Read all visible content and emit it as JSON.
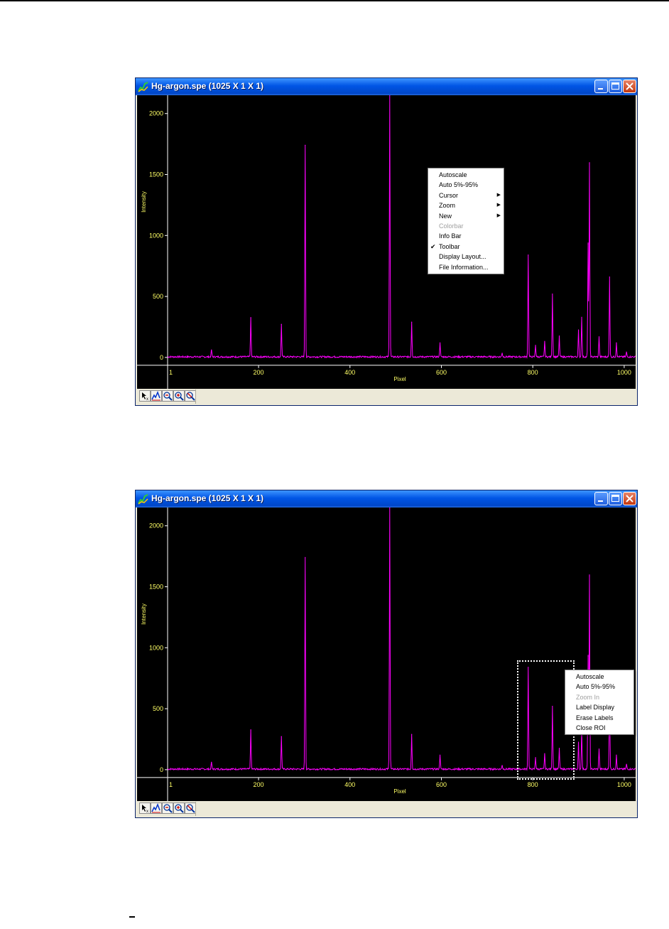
{
  "window_title": "Hg-argon.spe (1025 X 1 X 1)",
  "chart_data": {
    "type": "line",
    "xlabel": "Pixel",
    "ylabel": "Intensity",
    "xlim": [
      1,
      1025
    ],
    "ylim": [
      -30,
      2150
    ],
    "x_ticks": [
      1,
      200,
      400,
      600,
      800,
      1000
    ],
    "y_ticks": [
      0,
      500,
      1000,
      1500,
      2000
    ],
    "grid": false,
    "line_color": "#ff00ff",
    "axis_color": "#ffff66",
    "baseline": 5,
    "peaks": [
      {
        "x": 97,
        "y": 60
      },
      {
        "x": 183,
        "y": 320
      },
      {
        "x": 250,
        "y": 270
      },
      {
        "x": 302,
        "y": 1740
      },
      {
        "x": 487,
        "y": 2150
      },
      {
        "x": 535,
        "y": 290
      },
      {
        "x": 597,
        "y": 120
      },
      {
        "x": 733,
        "y": 35
      },
      {
        "x": 790,
        "y": 840
      },
      {
        "x": 806,
        "y": 100
      },
      {
        "x": 826,
        "y": 130
      },
      {
        "x": 843,
        "y": 520
      },
      {
        "x": 858,
        "y": 170
      },
      {
        "x": 900,
        "y": 220
      },
      {
        "x": 907,
        "y": 330
      },
      {
        "x": 921,
        "y": 930
      },
      {
        "x": 924,
        "y": 1590
      },
      {
        "x": 945,
        "y": 170
      },
      {
        "x": 968,
        "y": 660
      },
      {
        "x": 983,
        "y": 120
      },
      {
        "x": 1005,
        "y": 40
      }
    ]
  },
  "context_menu_1": {
    "items": [
      {
        "label": "Autoscale",
        "enabled": true,
        "submenu": false,
        "checked": false
      },
      {
        "label": "Auto 5%-95%",
        "enabled": true,
        "submenu": false,
        "checked": false
      },
      {
        "label": "Cursor",
        "enabled": true,
        "submenu": true,
        "checked": false
      },
      {
        "label": "Zoom",
        "enabled": true,
        "submenu": true,
        "checked": false
      },
      {
        "label": "New",
        "enabled": true,
        "submenu": true,
        "checked": false
      },
      {
        "label": "Colorbar",
        "enabled": false,
        "submenu": false,
        "checked": false
      },
      {
        "label": "Info Bar",
        "enabled": true,
        "submenu": false,
        "checked": false
      },
      {
        "label": "Toolbar",
        "enabled": true,
        "submenu": false,
        "checked": true
      },
      {
        "label": "Display Layout...",
        "enabled": true,
        "submenu": false,
        "checked": false
      },
      {
        "label": "File Information...",
        "enabled": true,
        "submenu": false,
        "checked": false
      }
    ]
  },
  "context_menu_2": {
    "items": [
      {
        "label": "Autoscale",
        "enabled": true
      },
      {
        "label": "Auto 5%-95%",
        "enabled": true
      },
      {
        "label": "Zoom In",
        "enabled": false
      },
      {
        "label": "Label Display",
        "enabled": true
      },
      {
        "label": "Erase Labels",
        "enabled": true
      },
      {
        "label": "Close ROI",
        "enabled": true
      }
    ]
  },
  "roi_range": {
    "x_start": 762,
    "x_end": 886
  }
}
